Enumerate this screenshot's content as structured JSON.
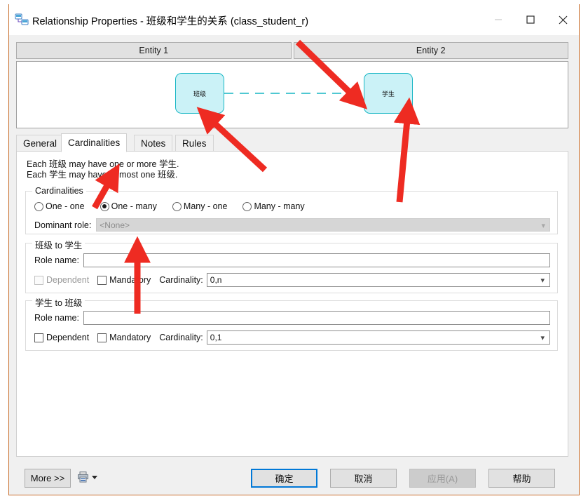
{
  "window": {
    "title": "Relationship Properties - 班级和学生的关系 (class_student_r)",
    "icon": "relationship-icon",
    "controls": {
      "minimize": "minimize-icon",
      "maximize": "maximize-icon",
      "close": "close-icon"
    },
    "border_color": "#c96f2e"
  },
  "diagram": {
    "headers": [
      "Entity 1",
      "Entity 2"
    ],
    "entity_left": "班级",
    "entity_right": "学生",
    "link_style": "dashed",
    "link_color": "#17b6c4",
    "entity_fill": "#cbf2f7",
    "entity_border": "#17b6c4",
    "notation_right_end": "crow-foot"
  },
  "tabs": [
    {
      "label": "General",
      "active": false
    },
    {
      "label": "Cardinalities",
      "active": true
    },
    {
      "label": "Notes",
      "active": false
    },
    {
      "label": "Rules",
      "active": false
    }
  ],
  "description": {
    "line1": "Each 班级 may have one or more 学生.",
    "line2": "Each 学生 may have at most one 班级."
  },
  "cardinalities_group": {
    "label": "Cardinalities",
    "options": [
      {
        "label": "One - one",
        "selected": false
      },
      {
        "label": "One - many",
        "selected": true
      },
      {
        "label": "Many - one",
        "selected": false
      },
      {
        "label": "Many - many",
        "selected": false
      }
    ],
    "dominant_role": {
      "label": "Dominant role:",
      "value": "<None>",
      "disabled": true
    }
  },
  "role_a_to_b": {
    "label": "班级 to 学生",
    "role_name_label": "Role name:",
    "role_name_value": "",
    "dependent_label": "Dependent",
    "dependent_checked": false,
    "dependent_disabled": true,
    "mandatory_label": "Mandatory",
    "mandatory_checked": false,
    "cardinality_label": "Cardinality:",
    "cardinality_value": "0,n"
  },
  "role_b_to_a": {
    "label": "学生 to 班级",
    "role_name_label": "Role name:",
    "role_name_value": "",
    "dependent_label": "Dependent",
    "dependent_checked": false,
    "dependent_disabled": false,
    "mandatory_label": "Mandatory",
    "mandatory_checked": false,
    "cardinality_label": "Cardinality:",
    "cardinality_value": "0,1"
  },
  "footer": {
    "more": "More >>",
    "print_icon": "printer-icon",
    "print_caret": "caret-down-icon",
    "ok": "确定",
    "cancel": "取消",
    "apply": "应用(A)",
    "help": "帮助",
    "default_button": "确定",
    "disabled_button": "应用(A)",
    "accent_color": "#0078d7"
  },
  "annotations": {
    "arrow_color": "#ee2b22",
    "arrows": [
      {
        "name": "arrow-to-entity-class",
        "points_to": "班级 entity box"
      },
      {
        "name": "arrow-to-entity-student",
        "points_to": "学生 entity box"
      },
      {
        "name": "arrow-to-crow-foot",
        "points_to": "crow's foot connector"
      },
      {
        "name": "arrow-to-tab-cardinalities",
        "points_to": "Cardinalities tab"
      },
      {
        "name": "arrow-to-one-many-radio",
        "points_to": "One - many radio button"
      }
    ]
  }
}
